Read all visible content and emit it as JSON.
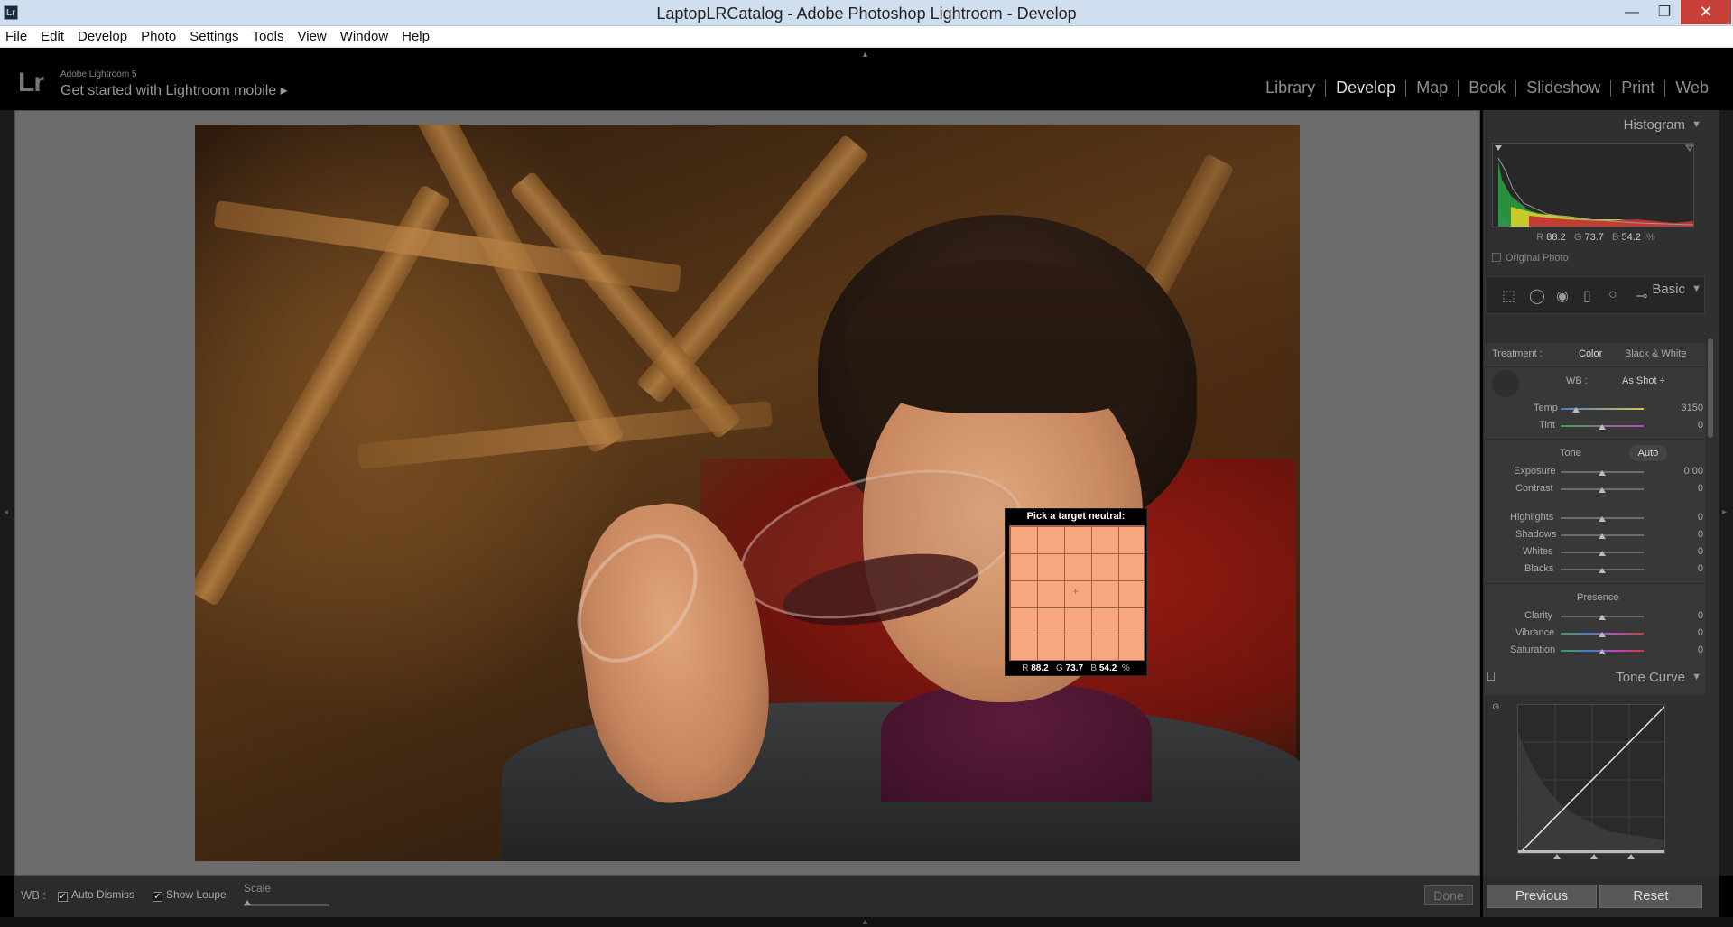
{
  "window": {
    "app_icon": "Lr",
    "title": "LaptopLRCatalog - Adobe Photoshop Lightroom - Develop",
    "minimize_glyph": "—",
    "maximize_glyph": "❐",
    "close_glyph": "✕"
  },
  "menu": [
    "File",
    "Edit",
    "Develop",
    "Photo",
    "Settings",
    "Tools",
    "View",
    "Window",
    "Help"
  ],
  "identity": {
    "logo": "Lr",
    "product": "Adobe Lightroom 5",
    "mobile_link": "Get started with Lightroom mobile ▸"
  },
  "modules": [
    {
      "label": "Library",
      "active": false
    },
    {
      "label": "Develop",
      "active": true
    },
    {
      "label": "Map",
      "active": false
    },
    {
      "label": "Book",
      "active": false
    },
    {
      "label": "Slideshow",
      "active": false
    },
    {
      "label": "Print",
      "active": false
    },
    {
      "label": "Web",
      "active": false
    }
  ],
  "loupe": {
    "title": "Pick a target neutral:",
    "r_label": "R",
    "r": "88.2",
    "g_label": "G",
    "g": "73.7",
    "b_label": "B",
    "b": "54.2",
    "unit": "%",
    "swatch_color": "#f7a77e"
  },
  "toolbar": {
    "wb_label": "WB :",
    "auto_dismiss": "Auto Dismiss",
    "show_loupe": "Show Loupe",
    "scale": "Scale",
    "done": "Done",
    "check_glyph": "✓"
  },
  "histogram": {
    "title": "Histogram",
    "r_label": "R",
    "r": "88.2",
    "g_label": "G",
    "g": "73.7",
    "b_label": "B",
    "b": "54.2",
    "unit": "%",
    "original_photo": "Original Photo"
  },
  "basic": {
    "title": "Basic",
    "treatment_label": "Treatment :",
    "treatment_color": "Color",
    "treatment_bw": "Black & White",
    "wb_label": "WB :",
    "wb_value": "As Shot ÷",
    "temp_label": "Temp",
    "temp_value": "3150",
    "tint_label": "Tint",
    "tint_value": "0",
    "tone_label": "Tone",
    "auto_label": "Auto",
    "exposure_label": "Exposure",
    "exposure_value": "0.00",
    "contrast_label": "Contrast",
    "contrast_value": "0",
    "highlights_label": "Highlights",
    "highlights_value": "0",
    "shadows_label": "Shadows",
    "shadows_value": "0",
    "whites_label": "Whites",
    "whites_value": "0",
    "blacks_label": "Blacks",
    "blacks_value": "0",
    "presence_label": "Presence",
    "clarity_label": "Clarity",
    "clarity_value": "0",
    "vibrance_label": "Vibrance",
    "vibrance_value": "0",
    "saturation_label": "Saturation",
    "saturation_value": "0"
  },
  "tone_curve": {
    "title": "Tone Curve"
  },
  "buttons": {
    "previous": "Previous",
    "reset": "Reset"
  },
  "colors": {
    "accent_panel": "#303030",
    "canvas_bg": "#6b6b6b",
    "close_red": "#c8403a"
  }
}
